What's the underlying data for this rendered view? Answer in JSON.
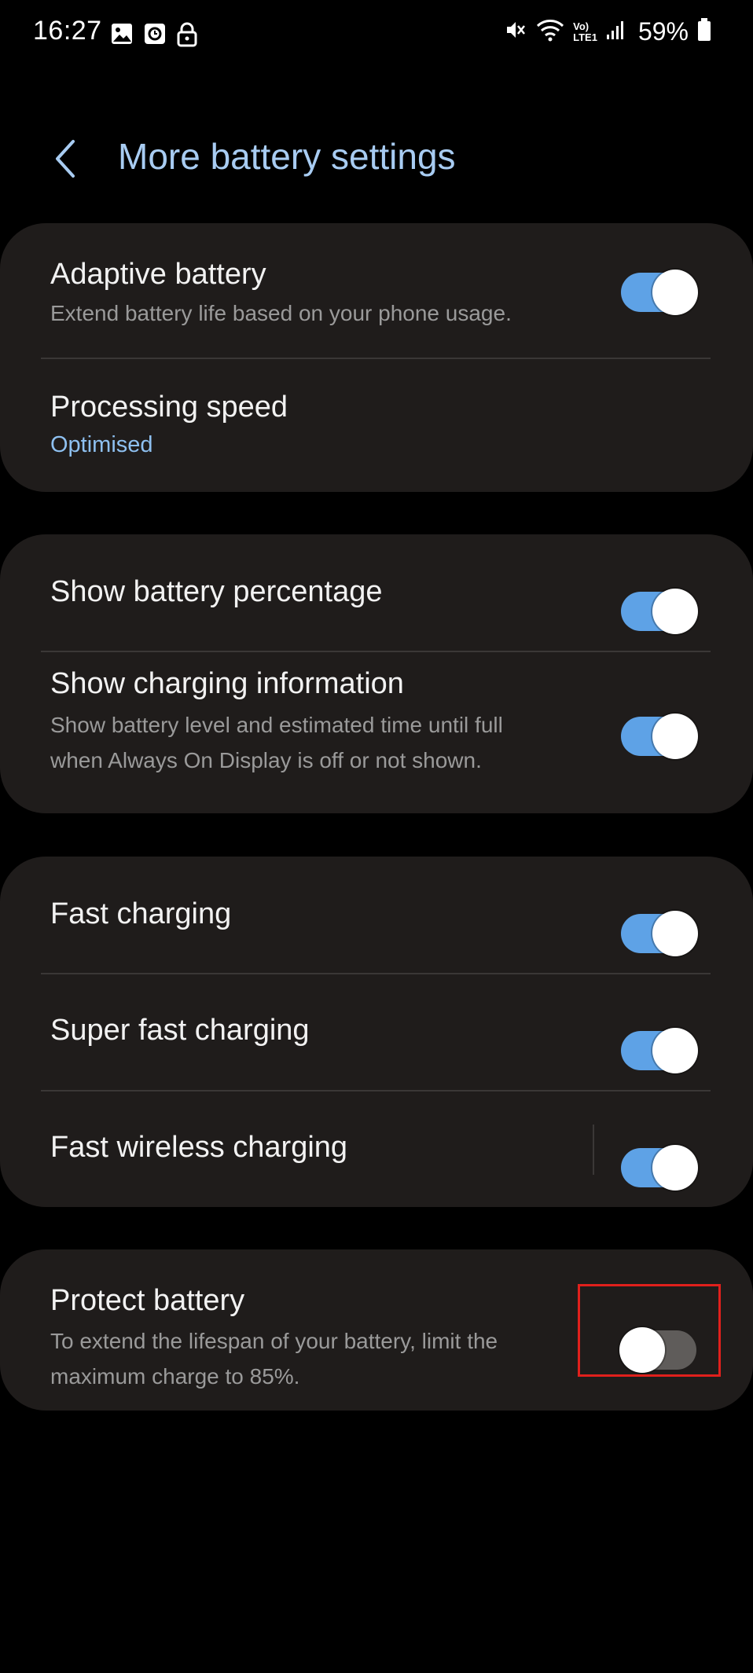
{
  "status_bar": {
    "time": "16:27",
    "left_icons": [
      "gallery-icon",
      "clock-app-icon",
      "lock-icon"
    ],
    "right_icons": [
      "mute-vibrate-icon",
      "wifi-icon",
      "volte-lte-icon",
      "signal-icon",
      "battery-icon"
    ],
    "battery_percent": "59%",
    "volte_label": "Vo)",
    "lte_label": "LTE1"
  },
  "header": {
    "back_icon": "chevron-left-icon",
    "title": "More battery settings"
  },
  "groups": [
    {
      "items": [
        {
          "title": "Adaptive battery",
          "subtitle": "Extend battery life based on your phone usage.",
          "toggle": true
        },
        {
          "title": "Processing speed",
          "value": "Optimised"
        }
      ]
    },
    {
      "items": [
        {
          "title": "Show battery percentage",
          "toggle": true
        },
        {
          "title": "Show charging information",
          "subtitle_line1": "Show battery level and estimated time until full",
          "subtitle_line2": "when Always On Display is off or not shown.",
          "toggle": true
        }
      ]
    },
    {
      "items": [
        {
          "title": "Fast charging",
          "toggle": true
        },
        {
          "title": "Super fast charging",
          "toggle": true
        },
        {
          "title": "Fast wireless charging",
          "toggle": true
        }
      ]
    },
    {
      "items": [
        {
          "title": "Protect battery",
          "subtitle_line1": "To extend the lifespan of your battery, limit the",
          "subtitle_line2": "maximum charge to 85%.",
          "toggle": false
        }
      ]
    }
  ],
  "colors": {
    "background": "#000000",
    "card": "#1f1c1b",
    "accent_title": "#a8ccf2",
    "toggle_on": "#5ea2e6",
    "toggle_off": "#5f5c5a",
    "highlight": "#e0201c"
  }
}
